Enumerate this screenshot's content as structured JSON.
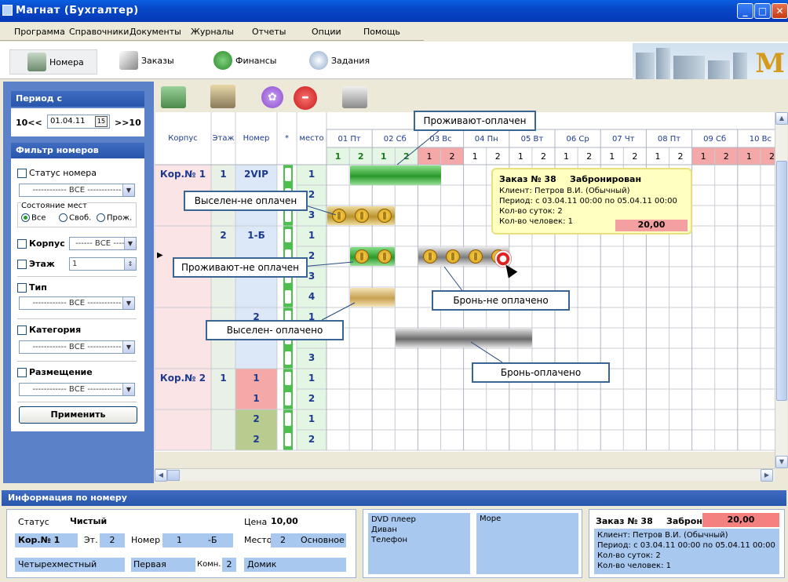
{
  "window": {
    "title": "Магнат (Бухгалтер)"
  },
  "menu": [
    "Программа",
    "Справочники",
    "Документы",
    "Журналы",
    "Отчеты",
    "Опции",
    "Помощь"
  ],
  "toolbar": {
    "tabs": [
      "Номера",
      "Заказы",
      "Финансы",
      "Задания"
    ]
  },
  "period": {
    "title": "Период с",
    "prev": "10<<",
    "date": "01.04.11",
    "cal_icon": "15",
    "next": ">>10"
  },
  "filter": {
    "title": "Фильтр номеров",
    "status_label": "Статус номера",
    "status_value": "------------ ВСЕ ------------",
    "places_label": "Состояние мест",
    "places_options": [
      "Все",
      "Своб.",
      "Прож."
    ],
    "corpus_label": "Корпус",
    "corpus_value": "------ ВСЕ ------",
    "floor_label": "Этаж",
    "floor_value": "1",
    "type_label": "Тип",
    "type_value": "------------ ВСЕ ------------",
    "category_label": "Категория",
    "category_value": "------------ ВСЕ ------------",
    "placement_label": "Размещение",
    "placement_value": "------------ ВСЕ ------------",
    "apply": "Применить"
  },
  "grid": {
    "headers": [
      "Корпус",
      "Этаж",
      "Номер",
      "*",
      "место"
    ],
    "days": [
      "01 Пт",
      "02 Сб",
      "03 Вс",
      "04 Пн",
      "05 Вт",
      "06 Ср",
      "07 Чт",
      "08 Пт",
      "09 Сб",
      "10 Вс"
    ],
    "day_sub": [
      "1",
      "2"
    ],
    "rows": [
      {
        "corpus": "Кор.№ 1",
        "floor": "1",
        "room": "2VIP",
        "place": "1"
      },
      {
        "corpus": "",
        "floor": "",
        "room": "",
        "place": "2"
      },
      {
        "corpus": "",
        "floor": "",
        "room": "",
        "place": "3"
      },
      {
        "corpus": "",
        "floor": "2",
        "room": "1-Б",
        "place": "1"
      },
      {
        "corpus": "",
        "floor": "",
        "room": "",
        "place": "2"
      },
      {
        "corpus": "",
        "floor": "",
        "room": "",
        "place": "3"
      },
      {
        "corpus": "",
        "floor": "",
        "room": "",
        "place": "4"
      },
      {
        "corpus": "",
        "floor": "",
        "room": "2",
        "place": "1"
      },
      {
        "corpus": "",
        "floor": "",
        "room": "",
        "place": "2"
      },
      {
        "corpus": "",
        "floor": "",
        "room": "",
        "place": "3"
      },
      {
        "corpus": "Кор.№ 2",
        "floor": "1",
        "room": "1",
        "place": "1"
      },
      {
        "corpus": "",
        "floor": "",
        "room": "1",
        "place": "2"
      },
      {
        "corpus": "",
        "floor": "",
        "room": "2",
        "place": "1"
      },
      {
        "corpus": "",
        "floor": "",
        "room": "2",
        "place": "2"
      }
    ]
  },
  "annotations": {
    "a1": "Проживают-оплачен",
    "a2": "Выселен-не оплачен",
    "a3": "Проживают-не оплачен",
    "a4": "Бронь-не оплачено",
    "a5": "Выселен- оплачено",
    "a6": "Бронь-оплачено"
  },
  "tooltip": {
    "order": "Заказ № 38",
    "state": "Забронирован",
    "client": "Клиент: Петров В.И. (Обычный)",
    "period": "Период: с 03.04.11 00:00 по 05.04.11 00:00",
    "nights": "Кол-во суток: 2",
    "people": "Кол-во человек: 1",
    "sum": "20,00"
  },
  "info": {
    "title": "Информация по номеру",
    "status_label": "Статус",
    "status_value": "Чистый",
    "price_label": "Цена",
    "price_value": "10,00",
    "corpus": "Кор.№ 1",
    "floor_label": "Эт.",
    "floor_value": "2",
    "room_label": "Номер",
    "room_value": "1",
    "room_suffix": "-Б",
    "place_label": "Место",
    "place_value": "2",
    "place_kind": "Основное",
    "room_type": "Четырехместный",
    "category": "Первая",
    "rooms_label": "Комн.",
    "rooms_value": "2",
    "building": "Домик",
    "amenities": [
      "DVD плеер",
      "Диван",
      "Телефон"
    ],
    "view": "Море",
    "order": "Заказ № 38",
    "order_state": "Забронирован",
    "order_sum": "20,00",
    "order_client": "Клиент: Петров В.И. (Обычный)",
    "order_period": "Период: с 03.04.11 00:00 по 05.04.11 00:00",
    "order_nights": "Кол-во суток: 2",
    "order_people": "Кол-во человек: 1"
  },
  "colors": {
    "accent": "#2856ac",
    "weekend": "#f4a8a8",
    "lived_paid": "#3aa53a",
    "booked_unpaid": "#8c8c8c",
    "coin": "#e8b830"
  }
}
